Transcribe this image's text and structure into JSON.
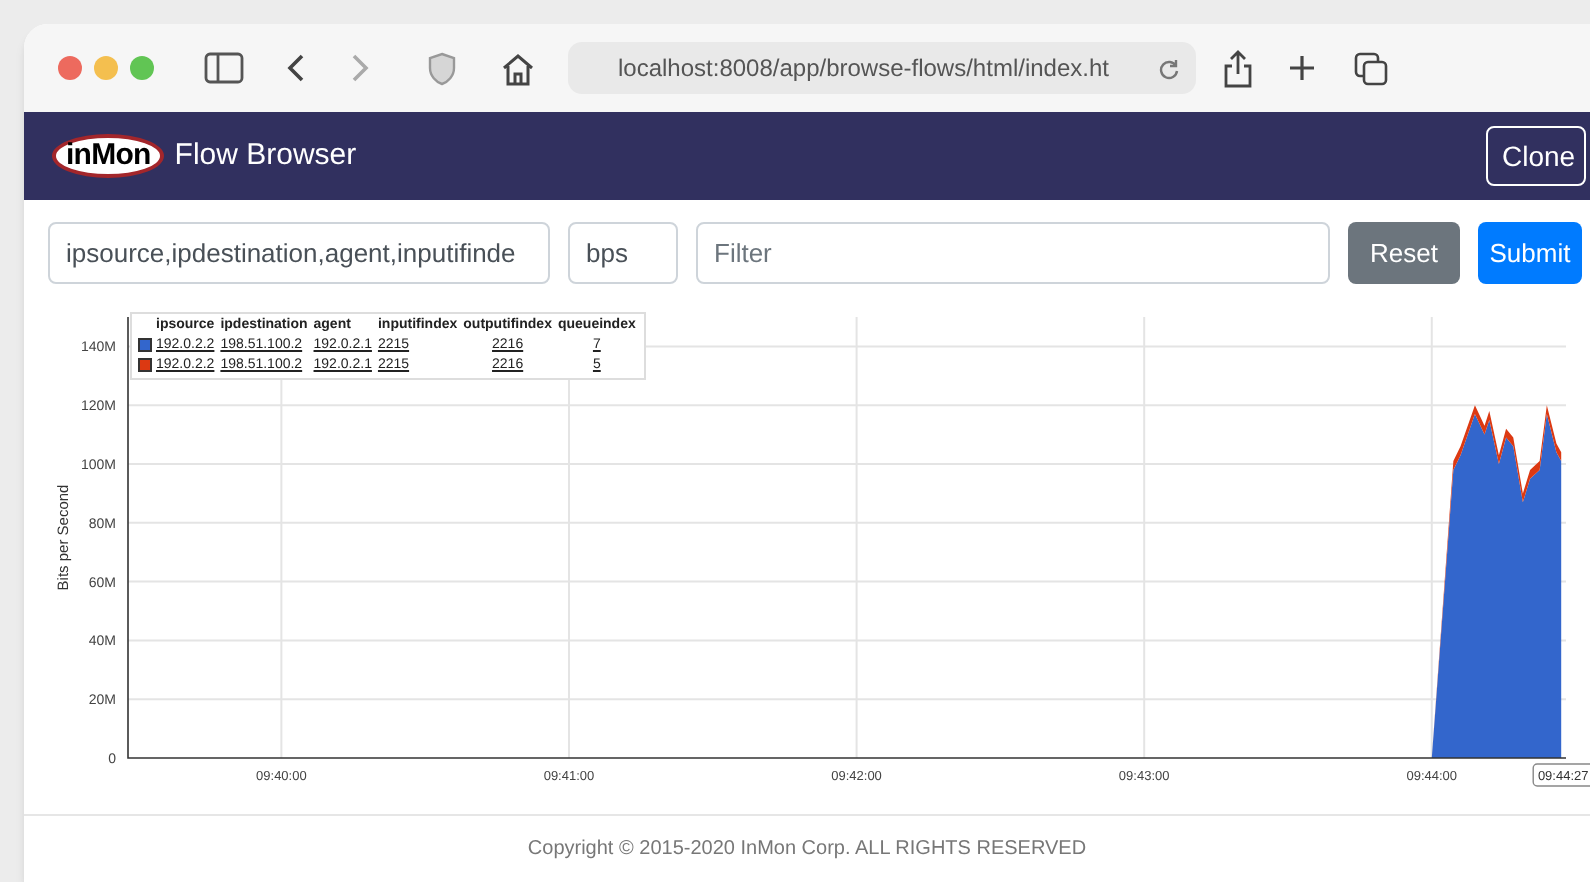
{
  "browser": {
    "address": "localhost:8008/app/browse-flows/html/index.ht"
  },
  "navbar": {
    "logo": "inMon",
    "title": "Flow Browser",
    "button": "Clone"
  },
  "query": {
    "keys": "ipsource,ipdestination,agent,inputifinde",
    "value": "bps",
    "filter_placeholder": "Filter",
    "buttons": [
      "Reset",
      "Submit"
    ]
  },
  "legend": {
    "columns": [
      "ipsource",
      "ipdestination",
      "agent",
      "inputifindex",
      "outputifindex",
      "queueindex"
    ],
    "rows": [
      {
        "color": "#3366cc",
        "cells": [
          "192.0.2.2",
          "198.51.100.2",
          "192.0.2.1",
          "2215",
          "2216",
          "7"
        ]
      },
      {
        "color": "#dc3912",
        "cells": [
          "192.0.2.2",
          "198.51.100.2",
          "192.0.2.1",
          "2215",
          "2216",
          "5"
        ]
      }
    ]
  },
  "chart_data": {
    "type": "area",
    "stacked": true,
    "ylabel": "Bits per Second",
    "x": [
      35040,
      35044.5,
      35046,
      35049,
      35051,
      35052,
      35054,
      35055.5,
      35057,
      35059,
      35060.5,
      35062.5,
      35064,
      35066,
      35067
    ],
    "series": [
      {
        "color": "#3366cc",
        "values": [
          0,
          98000000,
          103000000,
          117000000,
          110000000,
          115000000,
          100000000,
          109000000,
          106000000,
          87000000,
          95000000,
          98000000,
          117000000,
          104000000,
          101000000
        ]
      },
      {
        "color": "#dc3912",
        "values": [
          0,
          3000000,
          3000000,
          3000000,
          3000000,
          3000000,
          3000000,
          3000000,
          3000000,
          3000000,
          3000000,
          3000000,
          3000000,
          3000000,
          3000000
        ]
      }
    ],
    "xlim": [
      34768,
      35068
    ],
    "ylim": [
      0,
      150000000
    ],
    "xticks": [
      {
        "value": 34800,
        "label": "09:40:00"
      },
      {
        "value": 34860,
        "label": "09:41:00"
      },
      {
        "value": 34920,
        "label": "09:42:00"
      },
      {
        "value": 34980,
        "label": "09:43:00"
      },
      {
        "value": 35040,
        "label": "09:44:00"
      }
    ],
    "yticks": [
      {
        "value": 0,
        "label": "0"
      },
      {
        "value": 20000000,
        "label": "20M"
      },
      {
        "value": 40000000,
        "label": "40M"
      },
      {
        "value": 60000000,
        "label": "60M"
      },
      {
        "value": 80000000,
        "label": "80M"
      },
      {
        "value": 100000000,
        "label": "100M"
      },
      {
        "value": 120000000,
        "label": "120M"
      },
      {
        "value": 140000000,
        "label": "140M"
      }
    ],
    "grid": true,
    "annotations": [
      {
        "x": 35067,
        "text": "09:44:27"
      }
    ]
  },
  "footer": "Copyright © 2015-2020 InMon Corp. ALL RIGHTS RESERVED"
}
